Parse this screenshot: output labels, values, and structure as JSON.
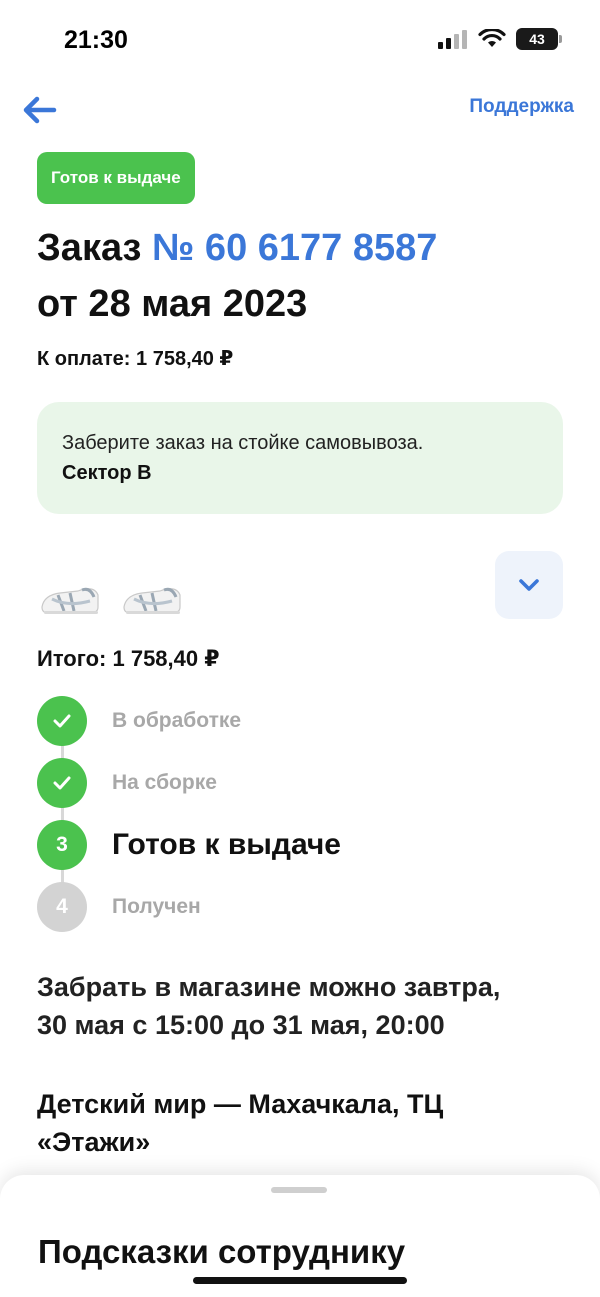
{
  "status_bar": {
    "time": "21:30",
    "battery": "43"
  },
  "nav": {
    "support_label": "Поддержка"
  },
  "order": {
    "status_chip": "Готов к выдаче",
    "title_prefix": "Заказ ",
    "number": "№ 60 6177 8587",
    "date_line": "от 28 мая 2023",
    "pay_line": "К оплате: 1 758,40 ₽"
  },
  "info": {
    "line1": "Заберите заказ на стойке самовывоза.",
    "line2": "Сектор B"
  },
  "total": "Итого: 1 758,40 ₽",
  "steps": [
    {
      "marker": "",
      "label": "В обработке",
      "state": "done"
    },
    {
      "marker": "",
      "label": "На сборке",
      "state": "done"
    },
    {
      "marker": "3",
      "label": "Готов к выдаче",
      "state": "current"
    },
    {
      "marker": "4",
      "label": "Получен",
      "state": "todo"
    }
  ],
  "pickup": {
    "line1": "Забрать в магазине можно завтра,",
    "line2": "30 мая с 15:00 до 31 мая, 20:00"
  },
  "store": {
    "line1": "Детский мир — Махачкала, ТЦ",
    "line2": "«Этажи»"
  },
  "sheet": {
    "title": "Подсказки сотруднику"
  },
  "colors": {
    "accent_blue": "#3b77d8",
    "status_green": "#4bc24e",
    "info_bg": "#e9f6e9"
  }
}
